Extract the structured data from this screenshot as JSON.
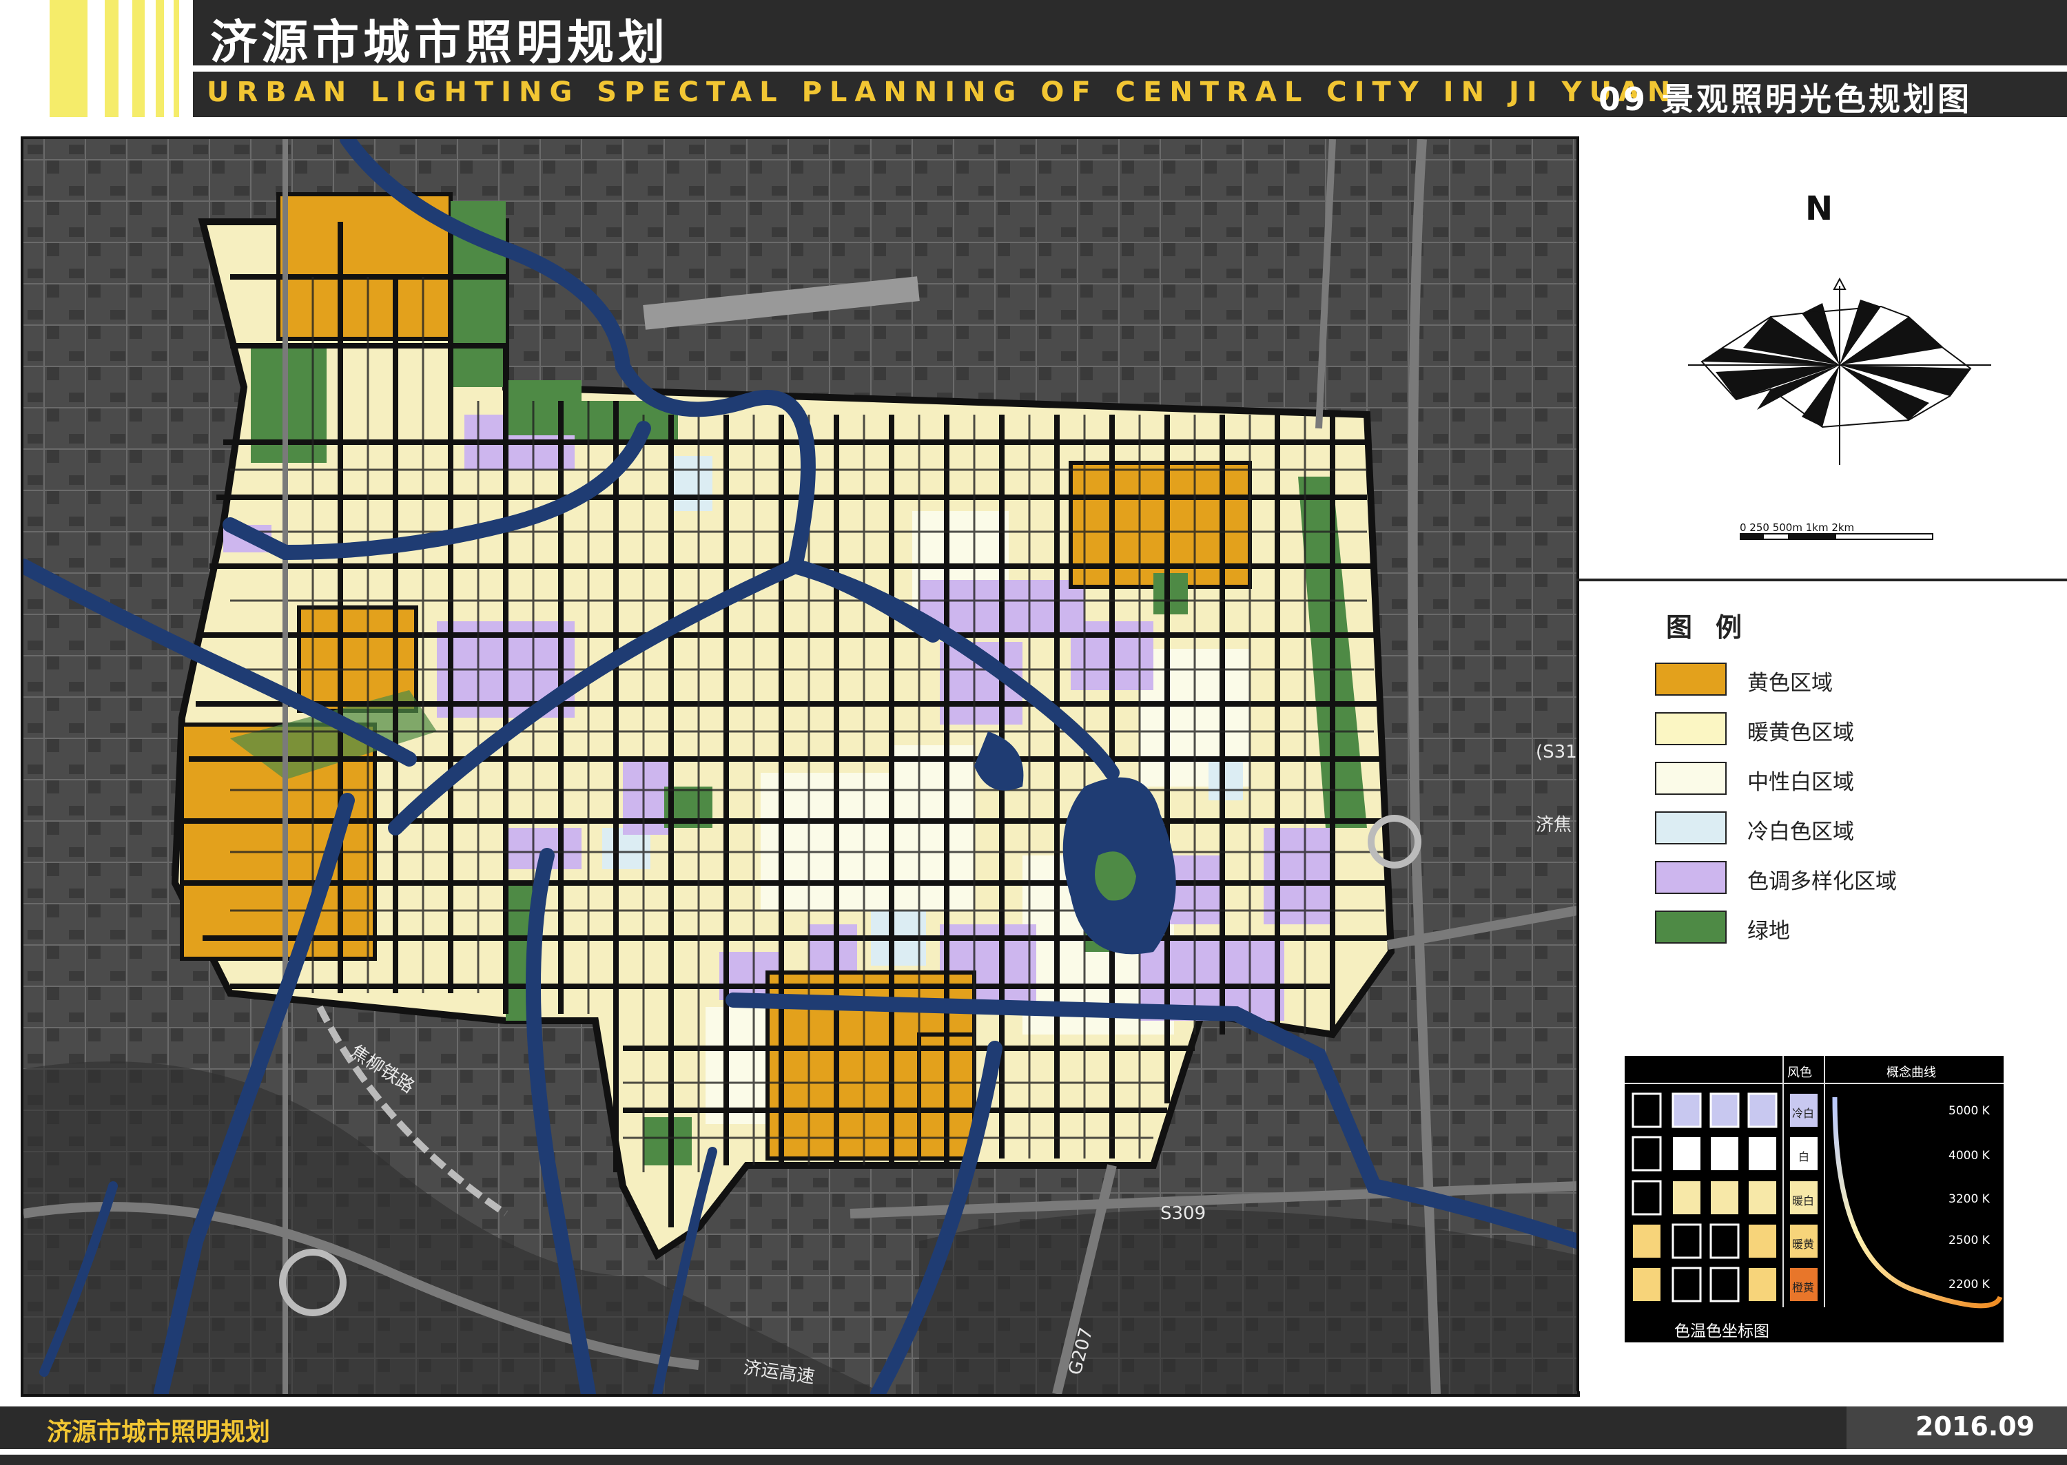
{
  "header": {
    "title": "济源市城市照明规划",
    "subtitle": "URBAN LIGHTING SPECTAL PLANNING OF CENTRAL CITY IN JI YUAN",
    "sheet_title": "09 景观照明光色规划图"
  },
  "footer": {
    "left": "济源市城市照明规划",
    "date": "2016.09"
  },
  "compass": {
    "north_label": "N"
  },
  "scale_bar": {
    "text": "0 250 500m   1km              2km"
  },
  "legend": {
    "title": "图例",
    "items": [
      {
        "label": "黄色区域",
        "color": "#e3a11c"
      },
      {
        "label": "暖黄色区域",
        "color": "#fbf6c3"
      },
      {
        "label": "中性白区域",
        "color": "#fbfbe8"
      },
      {
        "label": "冷白色区域",
        "color": "#dcedf3"
      },
      {
        "label": "色调多样化区域",
        "color": "#cdb6ee"
      },
      {
        "label": "绿地",
        "color": "#4e8a45"
      }
    ]
  },
  "cct_chart": {
    "caption": "色温色坐标图",
    "col_header_1": "风色",
    "col_header_2": "概念曲线",
    "rows": [
      {
        "label": "冷白",
        "kelvin": "5000 K",
        "color": "#c8c8f0"
      },
      {
        "label": "白",
        "kelvin": "4000 K",
        "color": "#ffffff"
      },
      {
        "label": "暖白",
        "kelvin": "3200 K",
        "color": "#f7e8a8"
      },
      {
        "label": "暖黄",
        "kelvin": "2500 K",
        "color": "#f7d47a"
      },
      {
        "label": "橙黄",
        "kelvin": "2200 K",
        "color": "#e8762a"
      }
    ]
  },
  "map_labels": {
    "railway": "焦柳铁路",
    "s309": "S309",
    "g207": "G207",
    "expressway": "济运高速",
    "jijiao": "济焦",
    "s31": "(S31"
  }
}
